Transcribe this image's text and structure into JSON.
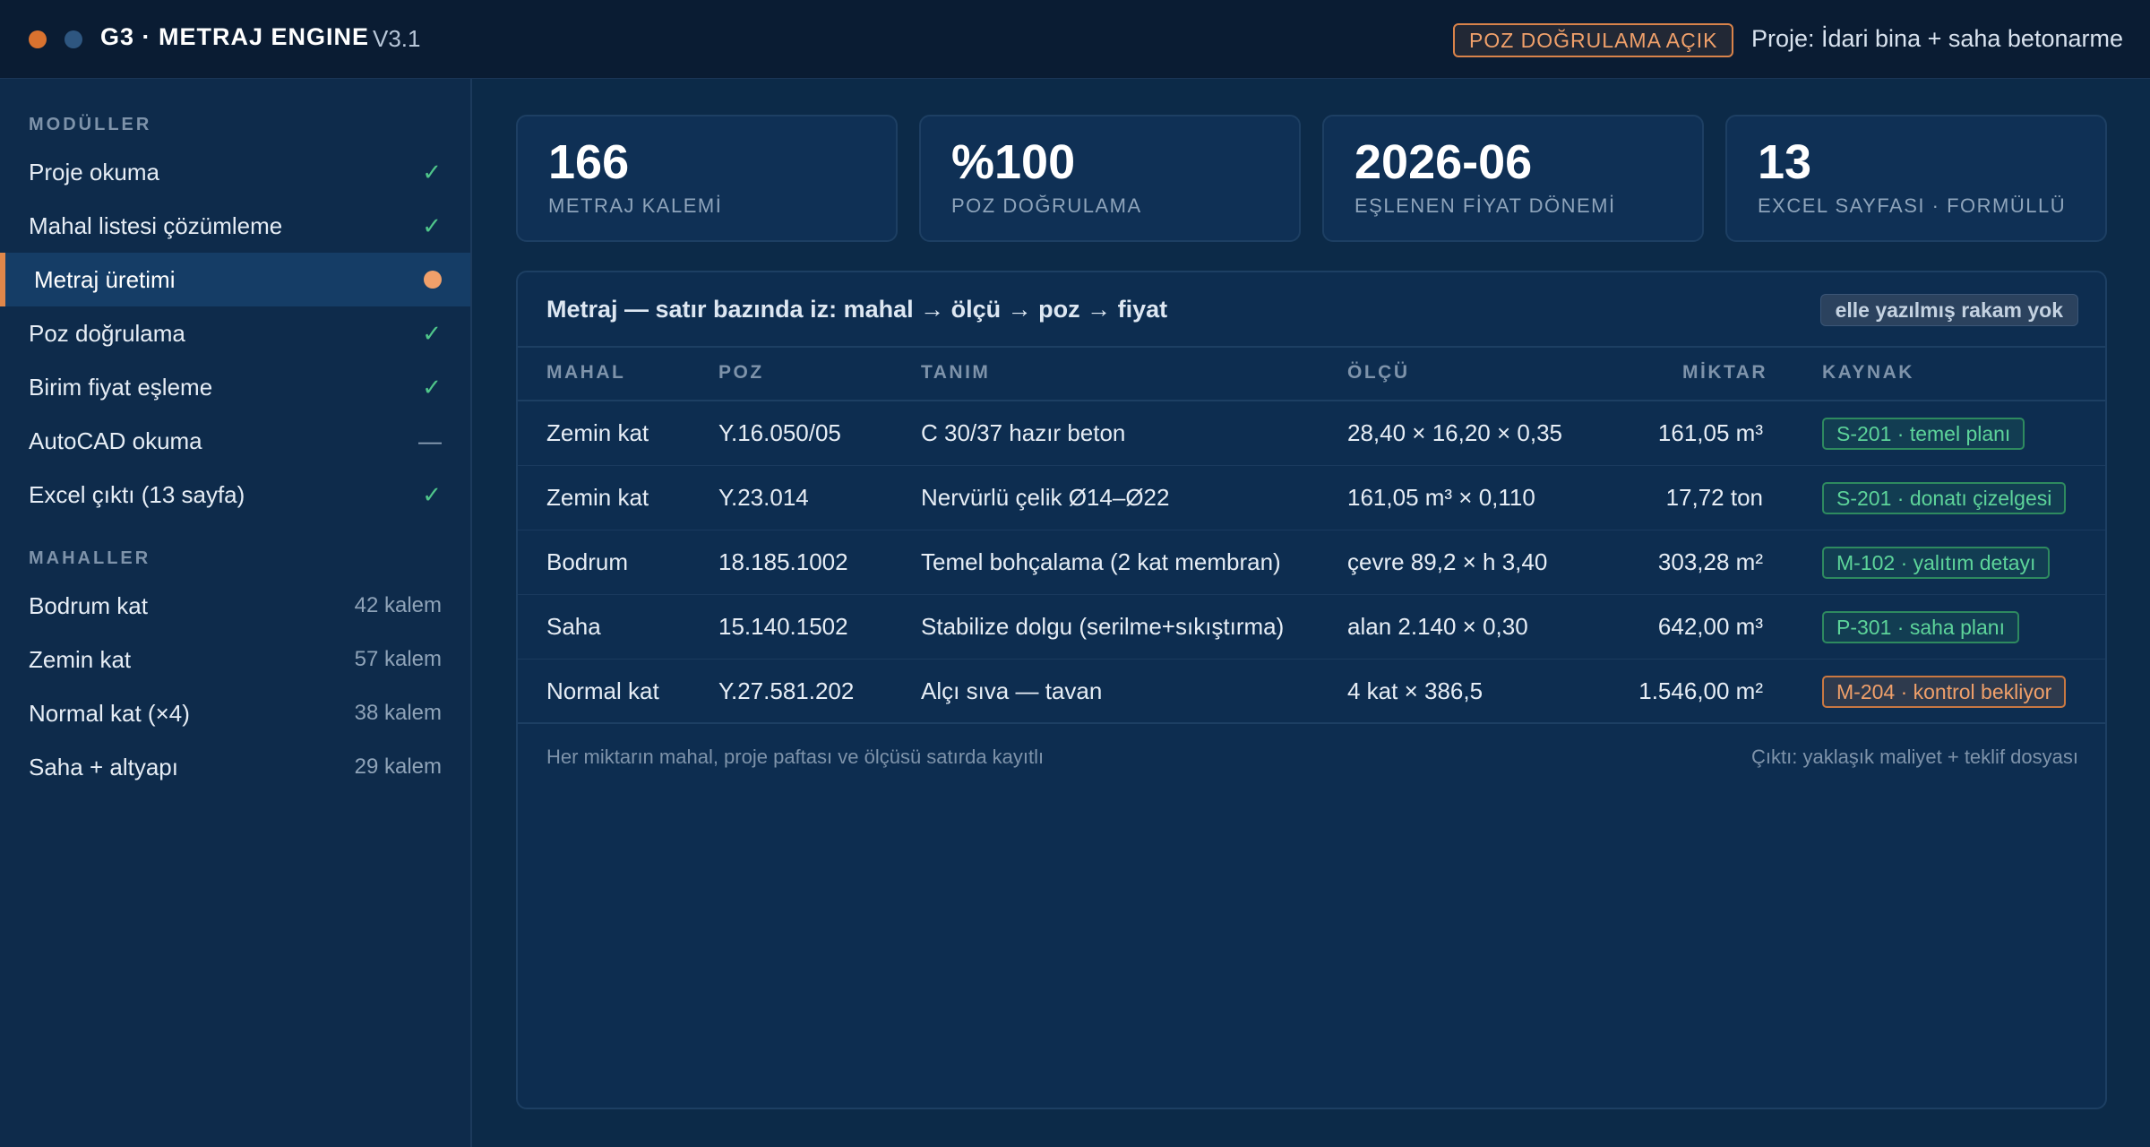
{
  "app": {
    "title": "G3 · METRAJ ENGINE",
    "version": "V3.1",
    "poz_badge": "POZ DOĞRULAMA AÇIK",
    "project": "Proje: İdari bina + saha betonarme",
    "dot_colors": [
      "#d9722f",
      "#2e5680"
    ]
  },
  "sidebar": {
    "modules_heading": "MODÜLLER",
    "modules": [
      {
        "label": "Proje okuma",
        "status": "✓",
        "state": "done"
      },
      {
        "label": "Mahal listesi çözümleme",
        "status": "✓",
        "state": "done"
      },
      {
        "label": "Metraj üretimi",
        "status": "",
        "state": "active"
      },
      {
        "label": "Poz doğrulama",
        "status": "✓",
        "state": "done"
      },
      {
        "label": "Birim fiyat eşleme",
        "status": "✓",
        "state": "done"
      },
      {
        "label": "AutoCAD okuma",
        "status": "—",
        "state": "skipped"
      },
      {
        "label": "Excel çıktı (13 sayfa)",
        "status": "✓",
        "state": "done"
      }
    ],
    "spaces_heading": "MAHALLER",
    "spaces": [
      {
        "label": "Bodrum kat",
        "count": "42 kalem"
      },
      {
        "label": "Zemin kat",
        "count": "57 kalem"
      },
      {
        "label": "Normal kat (×4)",
        "count": "38 kalem"
      },
      {
        "label": "Saha + altyapı",
        "count": "29 kalem"
      }
    ]
  },
  "stats": [
    {
      "value": "166",
      "label": "METRAJ KALEMİ"
    },
    {
      "value": "%100",
      "label": "POZ DOĞRULAMA"
    },
    {
      "value": "2026-06",
      "label": "EŞLENEN FİYAT DÖNEMİ"
    },
    {
      "value": "13",
      "label": "EXCEL SAYFASI · FORMÜLLÜ"
    }
  ],
  "panel": {
    "title": "Metraj — satır bazında iz: mahal → ölçü → poz → fiyat",
    "pill": "elle yazılmış rakam yok",
    "columns": [
      "MAHAL",
      "POZ",
      "TANIM",
      "ÖLÇÜ",
      "MİKTAR",
      "KAYNAK"
    ],
    "rows": [
      {
        "mahal": "Zemin kat",
        "poz": "Y.16.050/05",
        "tanim": "C 30/37 hazır beton",
        "olcu": "28,40 × 16,20 × 0,35",
        "miktar": "161,05 m³",
        "kaynak": "S-201 · temel planı",
        "tone": "green"
      },
      {
        "mahal": "Zemin kat",
        "poz": "Y.23.014",
        "tanim": "Nervürlü çelik Ø14–Ø22",
        "olcu": "161,05 m³ × 0,110",
        "miktar": "17,72 ton",
        "kaynak": "S-201 · donatı çizelgesi",
        "tone": "green"
      },
      {
        "mahal": "Bodrum",
        "poz": "18.185.1002",
        "tanim": "Temel bohçalama (2 kat membran)",
        "olcu": "çevre 89,2 × h 3,40",
        "miktar": "303,28 m²",
        "kaynak": "M-102 · yalıtım detayı",
        "tone": "green"
      },
      {
        "mahal": "Saha",
        "poz": "15.140.1502",
        "tanim": "Stabilize dolgu (serilme+sıkıştırma)",
        "olcu": "alan 2.140 × 0,30",
        "miktar": "642,00 m³",
        "kaynak": "P-301 · saha planı",
        "tone": "green"
      },
      {
        "mahal": "Normal kat",
        "poz": "Y.27.581.202",
        "tanim": "Alçı sıva — tavan",
        "olcu": "4 kat × 386,5",
        "miktar": "1.546,00 m²",
        "kaynak": "M-204 · kontrol bekliyor",
        "tone": "orange"
      }
    ],
    "footer_left": "Her miktarın mahal, proje paftası ve ölçüsü satırda kayıtlı",
    "footer_right": "Çıktı: yaklaşık maliyet + teklif dosyası"
  }
}
